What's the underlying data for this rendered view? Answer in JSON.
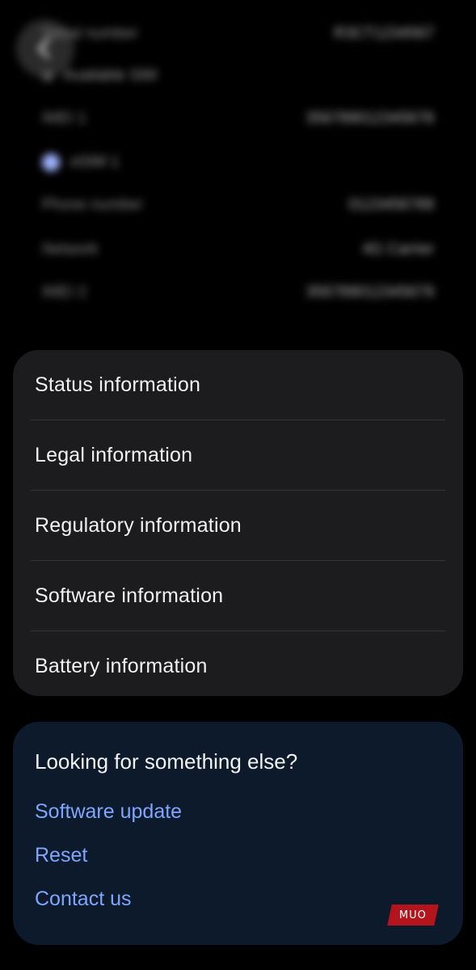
{
  "blurred_section": {
    "rows": [
      {
        "label": "Serial number",
        "value": "R3CT1234567"
      },
      {
        "label": "Available SIM",
        "value": ""
      },
      {
        "label": "IMEI 1",
        "value": "356789012345678"
      },
      {
        "label": "eSIM 1",
        "value": ""
      },
      {
        "label": "Phone number",
        "value": "0123456789"
      },
      {
        "label": "Network",
        "value": "4G Carrier"
      },
      {
        "label": "IMEI 2",
        "value": "356789012345679"
      }
    ]
  },
  "info_list": {
    "items": [
      {
        "label": "Status information"
      },
      {
        "label": "Legal information"
      },
      {
        "label": "Regulatory information"
      },
      {
        "label": "Software information"
      },
      {
        "label": "Battery information"
      }
    ]
  },
  "looking": {
    "title": "Looking for something else?",
    "links": [
      {
        "label": "Software update"
      },
      {
        "label": "Reset"
      },
      {
        "label": "Contact us"
      }
    ]
  },
  "watermark": {
    "text": "MUO"
  },
  "colors": {
    "background": "#000000",
    "card": "#1c1c1e",
    "looking_card": "#0d1a2b",
    "link": "#7ea6ff",
    "watermark": "#b4141c"
  }
}
